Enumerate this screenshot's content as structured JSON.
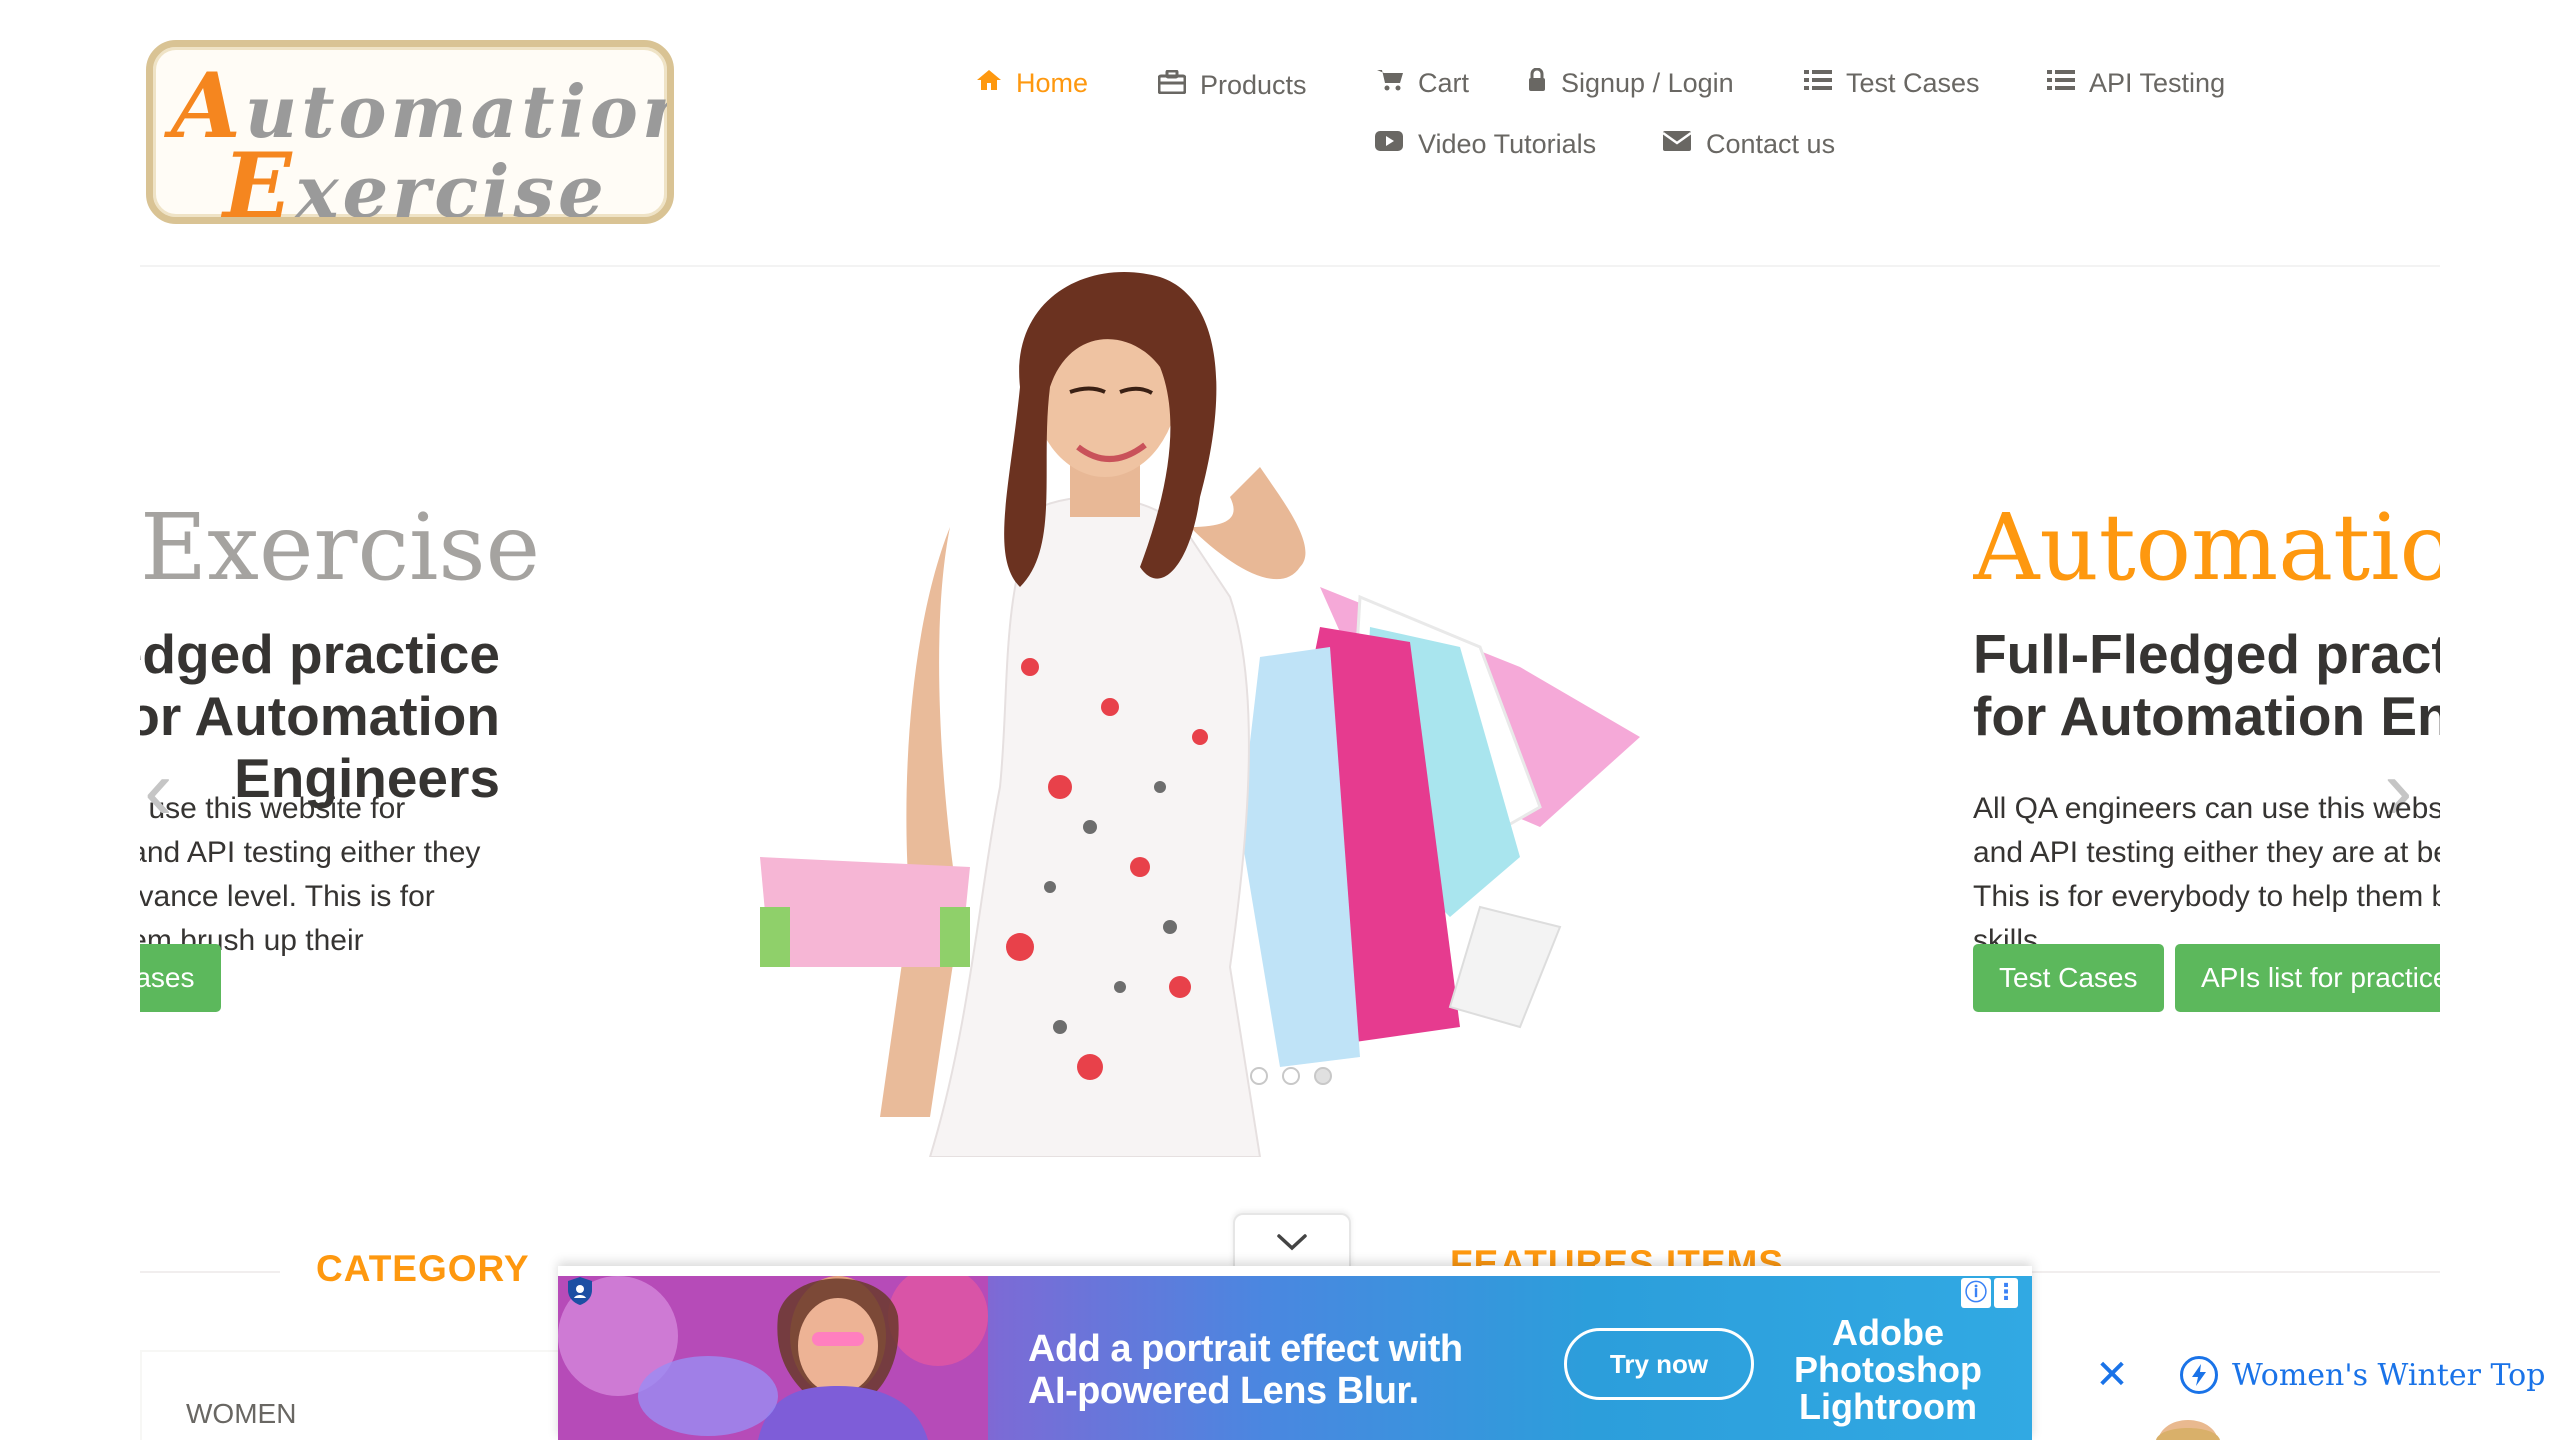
{
  "logo": {
    "line1": "Automation",
    "line2": "Exercise"
  },
  "nav": {
    "home": "Home",
    "products": "Products",
    "cart": "Cart",
    "signup_login": "Signup / Login",
    "test_cases": "Test Cases",
    "api_testing": "API Testing",
    "video_tutorials": "Video Tutorials",
    "contact_us": "Contact us"
  },
  "slider": {
    "left_slide": {
      "brand_word": "Exercise",
      "heading": "Full-Fledged practice website for Automation Engineers",
      "text": "All QA engineers can use this website for automation practice and API testing either they are at beginner or advance level. This is for everybody to help them brush up their automation skills.",
      "button": "Test Cases"
    },
    "right_slide": {
      "brand_word": "Automation",
      "heading": "Full-Fledged practice website for Automation Engineers",
      "text": "All QA engineers can use this website for automation practice and API testing either they are at beginner or advance level. This is for everybody to help them brush up their automation skills.",
      "button_primary": "Test Cases",
      "button_secondary": "APIs list for practice"
    },
    "prev_arrow": "‹",
    "next_arrow": "›"
  },
  "sections": {
    "category_title": "CATEGORY",
    "features_title": "FEATURES ITEMS",
    "categories": [
      "WOMEN"
    ]
  },
  "ad": {
    "headline_line1": "Add a portrait effect with",
    "headline_line2": "AI-powered Lens Blur.",
    "cta": "Try now",
    "brand_line1": "Adobe",
    "brand_line2": "Photoshop",
    "brand_line3": "Lightroom",
    "info_glyph": "ⓘ",
    "more_glyph": "⋮"
  },
  "side_ad": {
    "close": "✕",
    "label": "Women's Winter Top"
  },
  "colors": {
    "accent": "#fe980f",
    "button_green": "#5cb85c",
    "text": "#696763",
    "ad_link": "#1a73e8"
  }
}
